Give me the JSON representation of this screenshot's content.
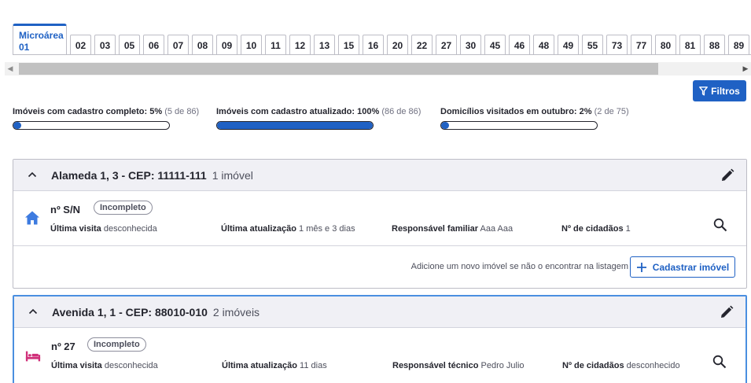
{
  "tabs": {
    "active": {
      "line1": "Microárea",
      "line2": "01"
    },
    "items": [
      "02",
      "03",
      "05",
      "06",
      "07",
      "08",
      "09",
      "10",
      "11",
      "12",
      "13",
      "15",
      "16",
      "20",
      "22",
      "27",
      "30",
      "45",
      "46",
      "48",
      "49",
      "55",
      "73",
      "77",
      "80",
      "81",
      "88",
      "89"
    ]
  },
  "toolbar": {
    "filter_label": "Filtros"
  },
  "progress": [
    {
      "label": "Imóveis com cadastro completo: 5%",
      "sub": "(5 de 86)",
      "value": 0.05
    },
    {
      "label": "Imóveis com cadastro atualizado: 100%",
      "sub": "(86 de 86)",
      "value": 1.0
    },
    {
      "label": "Domicílios visitados em outubro: 2%",
      "sub": "(2 de 75)",
      "value": 0.02
    }
  ],
  "streets": [
    {
      "title": "Alameda 1, 3 - CEP: 11111-111",
      "count": "1 imóvel",
      "home": {
        "number": "nº S/N",
        "badge": "Incompleto",
        "fields": [
          {
            "label": "Última visita",
            "value": "desconhecida"
          },
          {
            "label": "Última atualização",
            "value": "1 mês e 3 dias"
          },
          {
            "label": "Responsável familiar",
            "value": "Aaa Aaa"
          },
          {
            "label": "Nº de cidadãos",
            "value": "1"
          }
        ]
      },
      "footer": {
        "text": "Adicione um novo imóvel se não o encontrar na listagem",
        "button": "Cadastrar imóvel"
      }
    },
    {
      "title": "Avenida 1, 1 - CEP: 88010-010",
      "count": "2 imóveis",
      "home": {
        "number": "nº 27",
        "badge": "Incompleto",
        "fields": [
          {
            "label": "Última visita",
            "value": "desconhecida"
          },
          {
            "label": "Última atualização",
            "value": "11 dias"
          },
          {
            "label": "Responsável técnico",
            "value": "Pedro Julio"
          },
          {
            "label": "Nº de cidadãos",
            "value": "desconhecido"
          }
        ]
      }
    }
  ],
  "colors": {
    "accent": "#1f61c4",
    "home_icon": "#3d7be0",
    "bed_icon": "#d0307a"
  }
}
